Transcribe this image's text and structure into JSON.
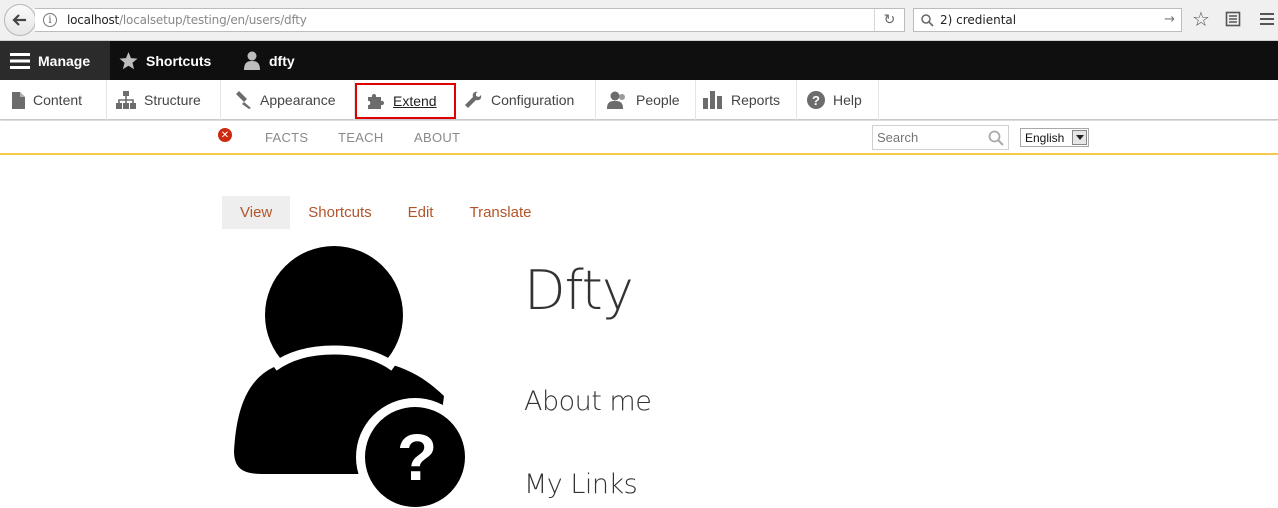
{
  "browser": {
    "url_host": "localhost",
    "url_path": "/localsetup/testing/en/users/dfty",
    "search_value": "2) crediental"
  },
  "toolbar": {
    "manage": "Manage",
    "shortcuts": "Shortcuts",
    "user": "dfty"
  },
  "tray": {
    "items": [
      {
        "label": "Content",
        "icon": "file-icon"
      },
      {
        "label": "Structure",
        "icon": "sitemap-icon"
      },
      {
        "label": "Appearance",
        "icon": "brush-icon"
      },
      {
        "label": "Extend",
        "icon": "puzzle-icon"
      },
      {
        "label": "Configuration",
        "icon": "wrench-icon"
      },
      {
        "label": "People",
        "icon": "people-icon"
      },
      {
        "label": "Reports",
        "icon": "bar-chart-icon"
      },
      {
        "label": "Help",
        "icon": "help-icon"
      }
    ]
  },
  "site_nav": {
    "links": [
      "FACTS",
      "TEACH",
      "ABOUT"
    ],
    "search_placeholder": "Search",
    "language": "English"
  },
  "tabs": [
    "View",
    "Shortcuts",
    "Edit",
    "Translate"
  ],
  "profile": {
    "name": "Dfty",
    "about_heading": "About me",
    "links_heading": "My Links"
  }
}
